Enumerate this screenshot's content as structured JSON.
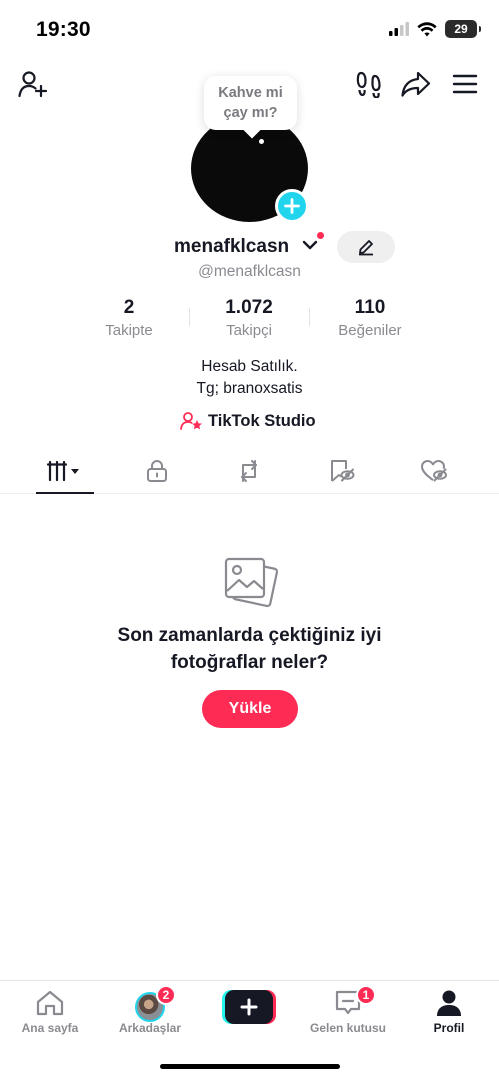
{
  "status": {
    "time": "19:30",
    "battery": "29"
  },
  "top_nav": {
    "icons": [
      "add-friend-icon",
      "footprints-icon",
      "share-icon",
      "menu-icon"
    ]
  },
  "profile": {
    "bubble_line1": "Kahve mi",
    "bubble_line2": "çay mı?",
    "username": "menafklcasn",
    "handle": "@menafklcasn",
    "stats": [
      {
        "value": "2",
        "label": "Takipte"
      },
      {
        "value": "1.072",
        "label": "Takipçi"
      },
      {
        "value": "110",
        "label": "Beğeniler"
      }
    ],
    "bio_line1": "Hesab Satılık.",
    "bio_line2": "Tg; branoxsatis",
    "studio_label": "TikTok Studio"
  },
  "tabs": [
    "grid-icon",
    "lock-icon",
    "repost-icon",
    "saved-icon",
    "liked-icon"
  ],
  "empty_state": {
    "title_line1": "Son zamanlarda çektiğiniz iyi",
    "title_line2": "fotoğraflar neler?",
    "button": "Yükle"
  },
  "bottom_nav": {
    "home": "Ana sayfa",
    "friends": "Arkadaşlar",
    "friends_badge": "2",
    "inbox": "Gelen kutusu",
    "inbox_badge": "1",
    "profile": "Profil"
  },
  "colors": {
    "accent": "#fe2c55",
    "cyan": "#20d5ec",
    "text": "#161823",
    "muted": "#8a8b91"
  }
}
